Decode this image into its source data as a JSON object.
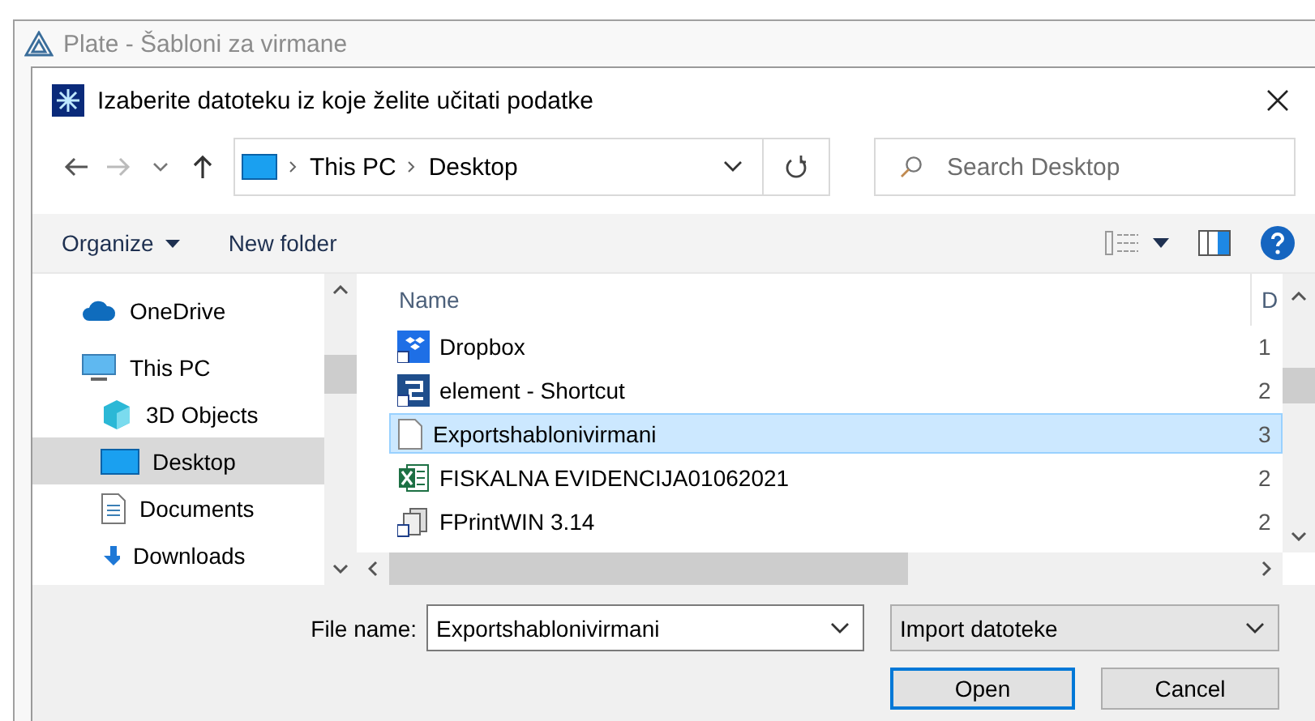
{
  "parent_window": {
    "title": "Plate - Šabloni za virmane"
  },
  "dialog": {
    "title": "Izaberite datoteku iz koje želite učitati podatke"
  },
  "address_bar": {
    "path": [
      "This PC",
      "Desktop"
    ]
  },
  "search": {
    "placeholder": "Search Desktop"
  },
  "toolbar": {
    "buttons": [
      {
        "label": "Organize",
        "has_menu": true
      },
      {
        "label": "New folder",
        "has_menu": false
      }
    ]
  },
  "nav_pane": {
    "items": [
      {
        "label": "OneDrive",
        "kind": "cloud",
        "selected": false
      },
      {
        "label": "This PC",
        "kind": "computer",
        "selected": false,
        "children": [
          {
            "label": "3D Objects",
            "kind": "cube",
            "selected": false
          },
          {
            "label": "Desktop",
            "kind": "desktop",
            "selected": true
          },
          {
            "label": "Documents",
            "kind": "document",
            "selected": false
          },
          {
            "label": "Downloads",
            "kind": "download",
            "selected": false
          }
        ]
      }
    ]
  },
  "file_list": {
    "columns": [
      "Name",
      "D"
    ],
    "rows": [
      {
        "name": "Dropbox",
        "kind": "dropbox",
        "column_2": "1",
        "selected": false
      },
      {
        "name": "element - Shortcut",
        "kind": "shortcut",
        "column_2": "2",
        "selected": false
      },
      {
        "name": "Exportshablonivirmani",
        "kind": "file",
        "column_2": "3",
        "selected": true
      },
      {
        "name": "FISKALNA EVIDENCIJA01062021",
        "kind": "excel",
        "column_2": "2",
        "selected": false
      },
      {
        "name": "FPrintWIN 3.14",
        "kind": "app",
        "column_2": "2",
        "selected": false
      }
    ]
  },
  "file_name": {
    "label": "File name:",
    "value": "Exportshablonivirmani"
  },
  "file_type": {
    "value": "Import datoteke"
  },
  "buttons": [
    {
      "label": "Open",
      "default": true
    },
    {
      "label": "Cancel",
      "default": false
    }
  ]
}
